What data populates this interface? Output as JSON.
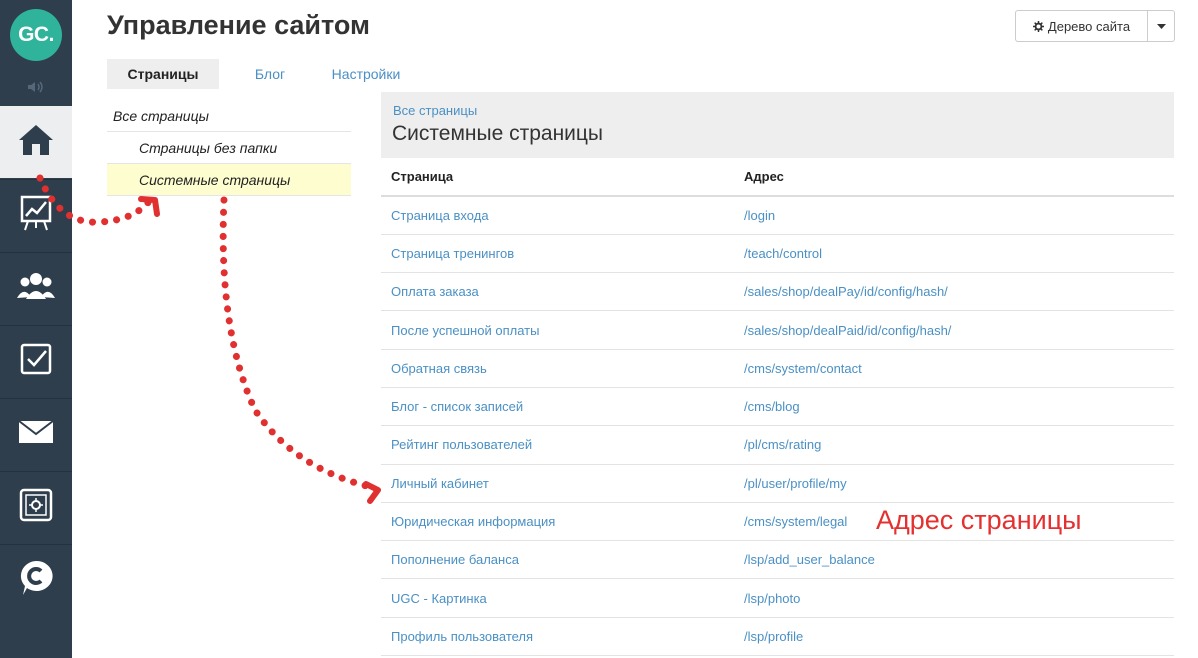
{
  "brand": {
    "logo_text": "GC."
  },
  "sidebar": {
    "items": [
      {
        "name": "home",
        "icon": "home-icon",
        "active": true
      },
      {
        "name": "stats",
        "icon": "chart-board-icon"
      },
      {
        "name": "users",
        "icon": "users-icon"
      },
      {
        "name": "tasks",
        "icon": "checkbox-icon"
      },
      {
        "name": "messages",
        "icon": "envelope-icon"
      },
      {
        "name": "safe",
        "icon": "safe-icon"
      },
      {
        "name": "chat",
        "icon": "chat-c-icon"
      }
    ]
  },
  "header": {
    "title": "Управление сайтом",
    "tree_button_label": "Дерево сайта"
  },
  "tabs": [
    {
      "label": "Страницы",
      "active": true
    },
    {
      "label": "Блог"
    },
    {
      "label": "Настройки"
    }
  ],
  "tree": {
    "items": [
      {
        "label": "Все страницы"
      },
      {
        "label": "Страницы без папки"
      },
      {
        "label": "Системные страницы",
        "selected": true
      }
    ]
  },
  "content": {
    "breadcrumb": "Все страницы",
    "title": "Системные страницы",
    "columns": [
      "Страница",
      "Адрес"
    ],
    "rows": [
      {
        "page": "Страница входа",
        "address": "/login"
      },
      {
        "page": "Страница тренингов",
        "address": "/teach/control"
      },
      {
        "page": "Оплата заказа",
        "address": "/sales/shop/dealPay/id/config/hash/"
      },
      {
        "page": "После успешной оплаты",
        "address": "/sales/shop/dealPaid/id/config/hash/"
      },
      {
        "page": "Обратная связь",
        "address": "/cms/system/contact"
      },
      {
        "page": "Блог - список записей",
        "address": "/cms/blog"
      },
      {
        "page": "Рейтинг пользователей",
        "address": "/pl/cms/rating"
      },
      {
        "page": "Личный кабинет",
        "address": "/pl/user/profile/my"
      },
      {
        "page": "Юридическая информация",
        "address": "/cms/system/legal"
      },
      {
        "page": "Пополнение баланса",
        "address": "/lsp/add_user_balance"
      },
      {
        "page": "UGC - Картинка",
        "address": "/lsp/photo"
      },
      {
        "page": "Профиль пользователя",
        "address": "/lsp/profile"
      }
    ]
  },
  "annotation": {
    "text": "Адрес страницы",
    "color": "#e53030"
  },
  "colors": {
    "sidebar": "#2f3e4c",
    "accent_link": "#4a90c4",
    "logo": "#2fb39a",
    "selected_row": "#fdfdd0"
  }
}
